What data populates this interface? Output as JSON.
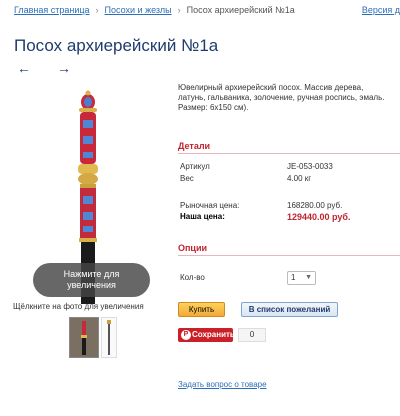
{
  "breadcrumb": {
    "home": "Главная страница",
    "category": "Посохи и жезлы",
    "current": "Посох архиерейский №1а",
    "version": "Версия д"
  },
  "product": {
    "title": "Посох архиерейский №1а",
    "description": "Ювелирный архиерейский посох. Массив дерева, латунь, гальваника, золочение, ручная роспись, эмаль. Размер: 6х150 см).",
    "prev_arrow": "←",
    "next_arrow": "→"
  },
  "gallery": {
    "zoom_line1": "Нажмите для",
    "zoom_line2": "увеличения",
    "hint": "Щёлкните на фото для увеличения"
  },
  "details": {
    "heading": "Детали",
    "article_label": "Артикул",
    "article_value": "JE-053-0033",
    "weight_label": "Вес",
    "weight_value": "4.00 кг",
    "market_label": "Рыночная цена:",
    "market_value": "168280.00 руб.",
    "our_label": "Наша цена:",
    "our_value": "129440.00 руб."
  },
  "options": {
    "heading": "Опции",
    "qty_label": "Кол-во",
    "qty_value": "1"
  },
  "actions": {
    "buy": "Купить",
    "wishlist": "В список пожеланий",
    "pin_label": "Сохранить",
    "pin_count": "0",
    "ask": "Задать вопрос о товаре"
  },
  "colors": {
    "title": "#1f3c6e",
    "accent_red": "#c0232f",
    "link": "#2d6eb8"
  }
}
